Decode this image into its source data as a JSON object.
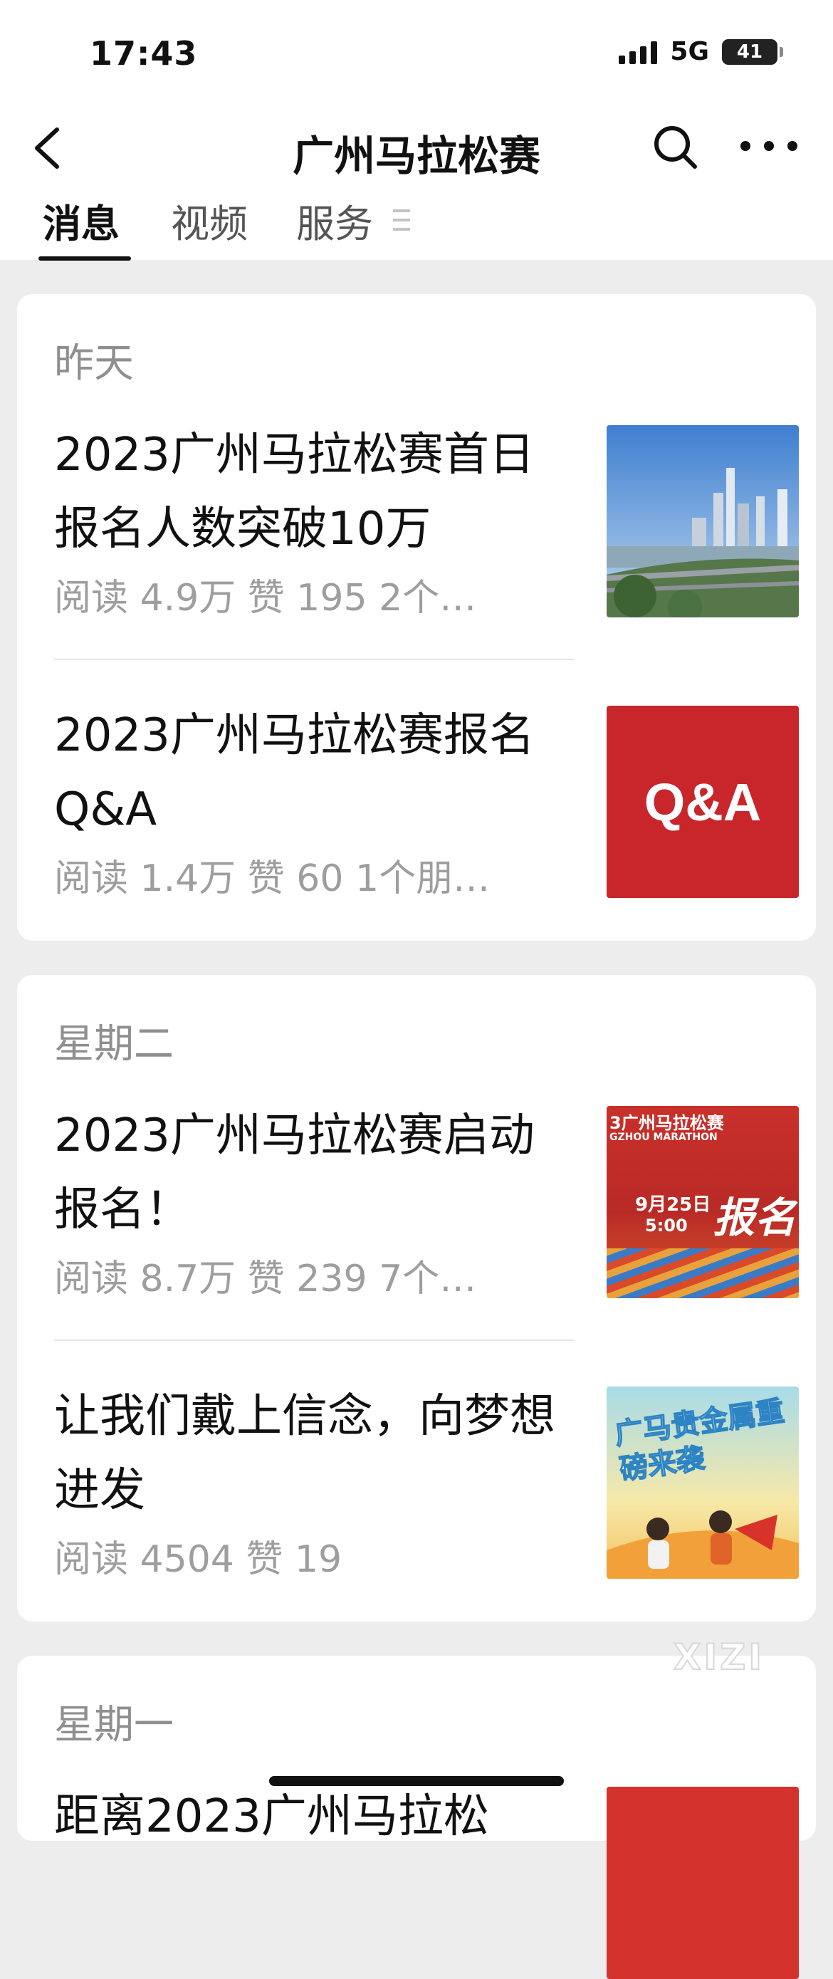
{
  "status_bar": {
    "time": "17:43",
    "network": "5G",
    "battery": "41"
  },
  "nav": {
    "title": "广州马拉松赛"
  },
  "tabs": [
    {
      "label": "消息",
      "active": true
    },
    {
      "label": "视频",
      "active": false
    },
    {
      "label": "服务",
      "active": false
    }
  ],
  "groups": [
    {
      "day": "昨天",
      "articles": [
        {
          "title": "2023广州马拉松赛首日报名人数突破10万",
          "meta": "阅读 4.9万  赞 195  2个…"
        },
        {
          "title": "2023广州马拉松赛报名Q&A",
          "meta": "阅读 1.4万  赞 60  1个朋…",
          "thumb_text": "Q&A"
        }
      ]
    },
    {
      "day": "星期二",
      "articles": [
        {
          "title": "2023广州马拉松赛启动报名！",
          "meta": "阅读 8.7万  赞 239  7个…",
          "thumb_top": "3广州马拉松赛",
          "thumb_sub": "GZHOU MARATHON",
          "thumb_date": "9月25日",
          "thumb_time": "5:00",
          "thumb_big": "报名"
        },
        {
          "title": "让我们戴上信念，向梦想进发",
          "meta": "阅读 4504  赞 19",
          "thumb_text": "广马贵金属重磅来袭"
        }
      ]
    },
    {
      "day": "星期一",
      "articles": [
        {
          "title": "距离2023广州马拉松",
          "meta": ""
        }
      ]
    }
  ],
  "watermark": "XIZI",
  "colors": {
    "qa_red": "#c8262b",
    "tab_active": "#111111",
    "meta_gray": "#9e9e9e"
  }
}
